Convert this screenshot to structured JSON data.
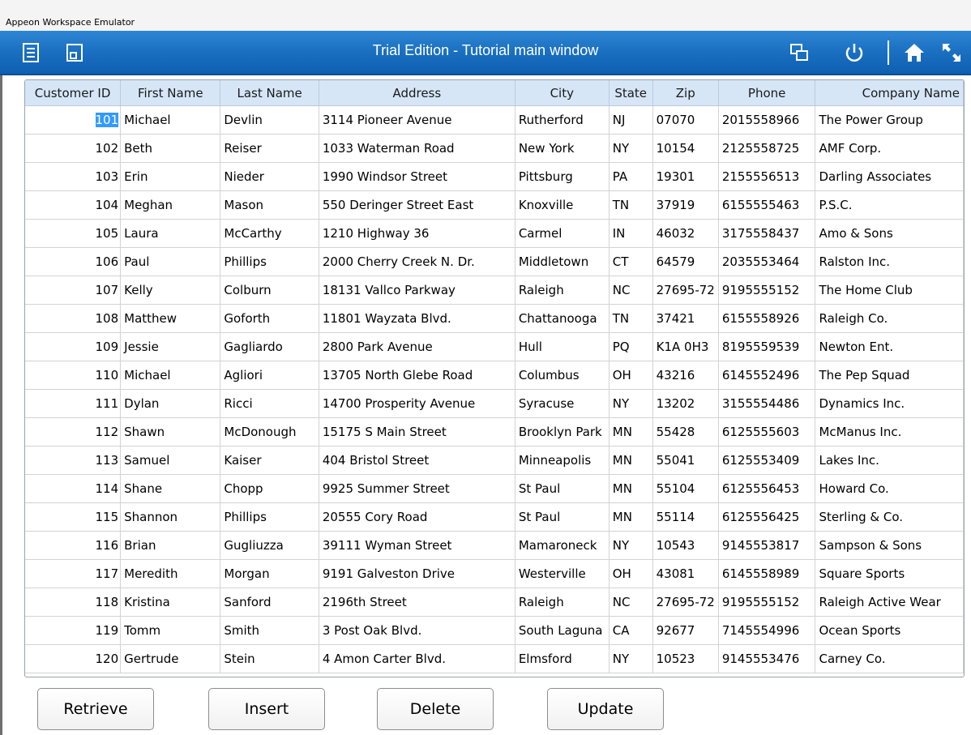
{
  "window": {
    "title": "Appeon Workspace Emulator"
  },
  "toolbar": {
    "heading": "Trial Edition - Tutorial main window",
    "icons": [
      "document-list-icon",
      "window-restore-icon",
      "cascade-windows-icon",
      "power-icon",
      "home-icon",
      "expand-icon"
    ]
  },
  "colors": {
    "toolbar": "#1a6fc0",
    "header": "#d6e6f7",
    "selection": "#3399ff"
  },
  "grid": {
    "columns": [
      "Customer ID",
      "First Name",
      "Last Name",
      "Address",
      "City",
      "State",
      "Zip",
      "Phone",
      "Company Name"
    ],
    "rows": [
      [
        "101",
        "Michael",
        "Devlin",
        "3114 Pioneer Avenue",
        "Rutherford",
        "NJ",
        "07070",
        "2015558966",
        "The Power Group"
      ],
      [
        "102",
        "Beth",
        "Reiser",
        "1033 Waterman Road",
        "New York",
        "NY",
        "10154",
        "2125558725",
        "AMF Corp."
      ],
      [
        "103",
        "Erin",
        "Nieder",
        "1990 Windsor Street",
        "Pittsburg",
        "PA",
        "19301",
        "2155556513",
        "Darling Associates"
      ],
      [
        "104",
        "Meghan",
        "Mason",
        "550 Deringer Street East",
        "Knoxville",
        "TN",
        "37919",
        "6155555463",
        "P.S.C."
      ],
      [
        "105",
        "Laura",
        "McCarthy",
        "1210 Highway 36",
        "Carmel",
        "IN",
        "46032",
        "3175558437",
        "Amo & Sons"
      ],
      [
        "106",
        "Paul",
        "Phillips",
        "2000 Cherry Creek N. Dr.",
        "Middletown",
        "CT",
        "64579",
        "2035553464",
        "Ralston Inc."
      ],
      [
        "107",
        "Kelly",
        "Colburn",
        "18131 Vallco Parkway",
        "Raleigh",
        "NC",
        "27695-72",
        "9195555152",
        "The Home Club"
      ],
      [
        "108",
        "Matthew",
        "Goforth",
        "11801 Wayzata Blvd.",
        "Chattanooga",
        "TN",
        "37421",
        "6155558926",
        "Raleigh Co."
      ],
      [
        "109",
        "Jessie",
        "Gagliardo",
        "2800 Park Avenue",
        "Hull",
        "PQ",
        "K1A 0H3",
        "8195559539",
        "Newton Ent."
      ],
      [
        "110",
        "Michael",
        "Agliori",
        "13705 North Glebe Road",
        "Columbus",
        "OH",
        "43216",
        "6145552496",
        "The Pep Squad"
      ],
      [
        "111",
        "Dylan",
        "Ricci",
        "14700 Prosperity Avenue",
        "Syracuse",
        "NY",
        "13202",
        "3155554486",
        "Dynamics Inc."
      ],
      [
        "112",
        "Shawn",
        "McDonough",
        "15175 S Main Street",
        "Brooklyn Park",
        "MN",
        "55428",
        "6125555603",
        "McManus Inc."
      ],
      [
        "113",
        "Samuel",
        "Kaiser",
        "404 Bristol Street",
        "Minneapolis",
        "MN",
        "55041",
        "6125553409",
        "Lakes Inc."
      ],
      [
        "114",
        "Shane",
        "Chopp",
        "9925 Summer Street",
        "St Paul",
        "MN",
        "55104",
        "6125556453",
        "Howard Co."
      ],
      [
        "115",
        "Shannon",
        "Phillips",
        "20555 Cory Road",
        "St Paul",
        "MN",
        "55114",
        "6125556425",
        "Sterling & Co."
      ],
      [
        "116",
        "Brian",
        "Gugliuzza",
        "39111 Wyman Street",
        "Mamaroneck",
        "NY",
        "10543",
        "9145553817",
        "Sampson & Sons"
      ],
      [
        "117",
        "Meredith",
        "Morgan",
        "9191 Galveston Drive",
        "Westerville",
        "OH",
        "43081",
        "6145558989",
        "Square Sports"
      ],
      [
        "118",
        "Kristina",
        "Sanford",
        "2196th Street",
        "Raleigh",
        "NC",
        "27695-72",
        "9195555152",
        "Raleigh Active Wear"
      ],
      [
        "119",
        "Tomm",
        "Smith",
        "3 Post Oak Blvd.",
        "South Laguna",
        "CA",
        "92677",
        "7145554996",
        "Ocean Sports"
      ],
      [
        "120",
        "Gertrude",
        "Stein",
        "4 Amon Carter Blvd.",
        "Elmsford",
        "NY",
        "10523",
        "9145553476",
        "Carney Co."
      ]
    ]
  },
  "buttons": {
    "retrieve": "Retrieve",
    "insert": "Insert",
    "delete": "Delete",
    "update": "Update"
  }
}
